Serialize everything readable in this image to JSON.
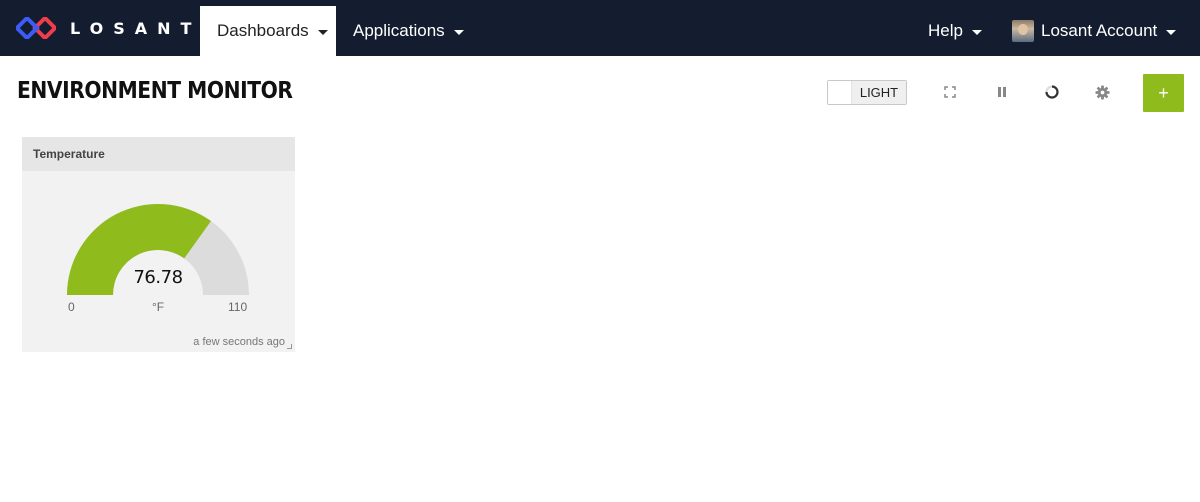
{
  "brand": {
    "name": "LOSANT"
  },
  "nav": {
    "dashboards_label": "Dashboards",
    "applications_label": "Applications",
    "help_label": "Help",
    "account_label": "Losant Account"
  },
  "dashboard": {
    "title": "ENVIRONMENT MONITOR",
    "theme_label": "LIGHT",
    "add_label": "+"
  },
  "gauge_block": {
    "title": "Temperature",
    "value": "76.78",
    "value_number": 76.78,
    "min": "0",
    "max": "110",
    "min_number": 0,
    "max_number": 110,
    "unit": "°F",
    "updated": "a few seconds ago",
    "fill_color": "#8fbb1c",
    "track_color": "#dcdcdc"
  },
  "colors": {
    "navbar": "#141c30",
    "accent": "#8fbb1c"
  },
  "icons": [
    "losant-logo",
    "caret-down-icon",
    "fullscreen-icon",
    "pause-icon",
    "refresh-icon",
    "gear-icon",
    "plus-icon",
    "resize-icon"
  ]
}
